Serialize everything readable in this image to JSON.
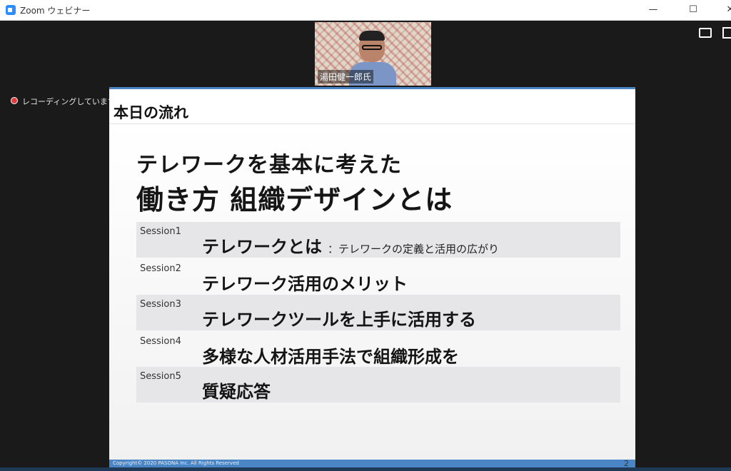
{
  "window": {
    "title": "Zoom ウェビナー",
    "controls": {
      "minimize": "—",
      "maximize": "☐",
      "close": "✕"
    }
  },
  "video": {
    "participant_name": "湯田健一郎氏"
  },
  "recording": {
    "status_text": "レコーディングしています"
  },
  "slide": {
    "title": "本日の流れ",
    "headline_line1": "テレワークを基本に考えた",
    "headline_line2": "働き方 組織デザインとは",
    "sessions": [
      {
        "label": "Session1",
        "topic": "テレワークとは",
        "subtitle": "：テレワークの定義と活用の広がり"
      },
      {
        "label": "Session2",
        "topic": "テレワーク活用のメリット",
        "subtitle": ""
      },
      {
        "label": "Session3",
        "topic": "テレワークツールを上手に活用する",
        "subtitle": ""
      },
      {
        "label": "Session4",
        "topic": "多様な人材活用手法で組織形成を",
        "subtitle": ""
      },
      {
        "label": "Session5",
        "topic": "質疑応答",
        "subtitle": ""
      }
    ],
    "footer_copyright": "Copyright© 2020 PASONA Inc. All Rights Reserved",
    "page_number": "2"
  },
  "colors": {
    "accent_blue": "#4a86c5",
    "zoom_blue": "#2d8cff",
    "recording_red": "#e23b3b",
    "row_shade": "#e6e5e7"
  }
}
